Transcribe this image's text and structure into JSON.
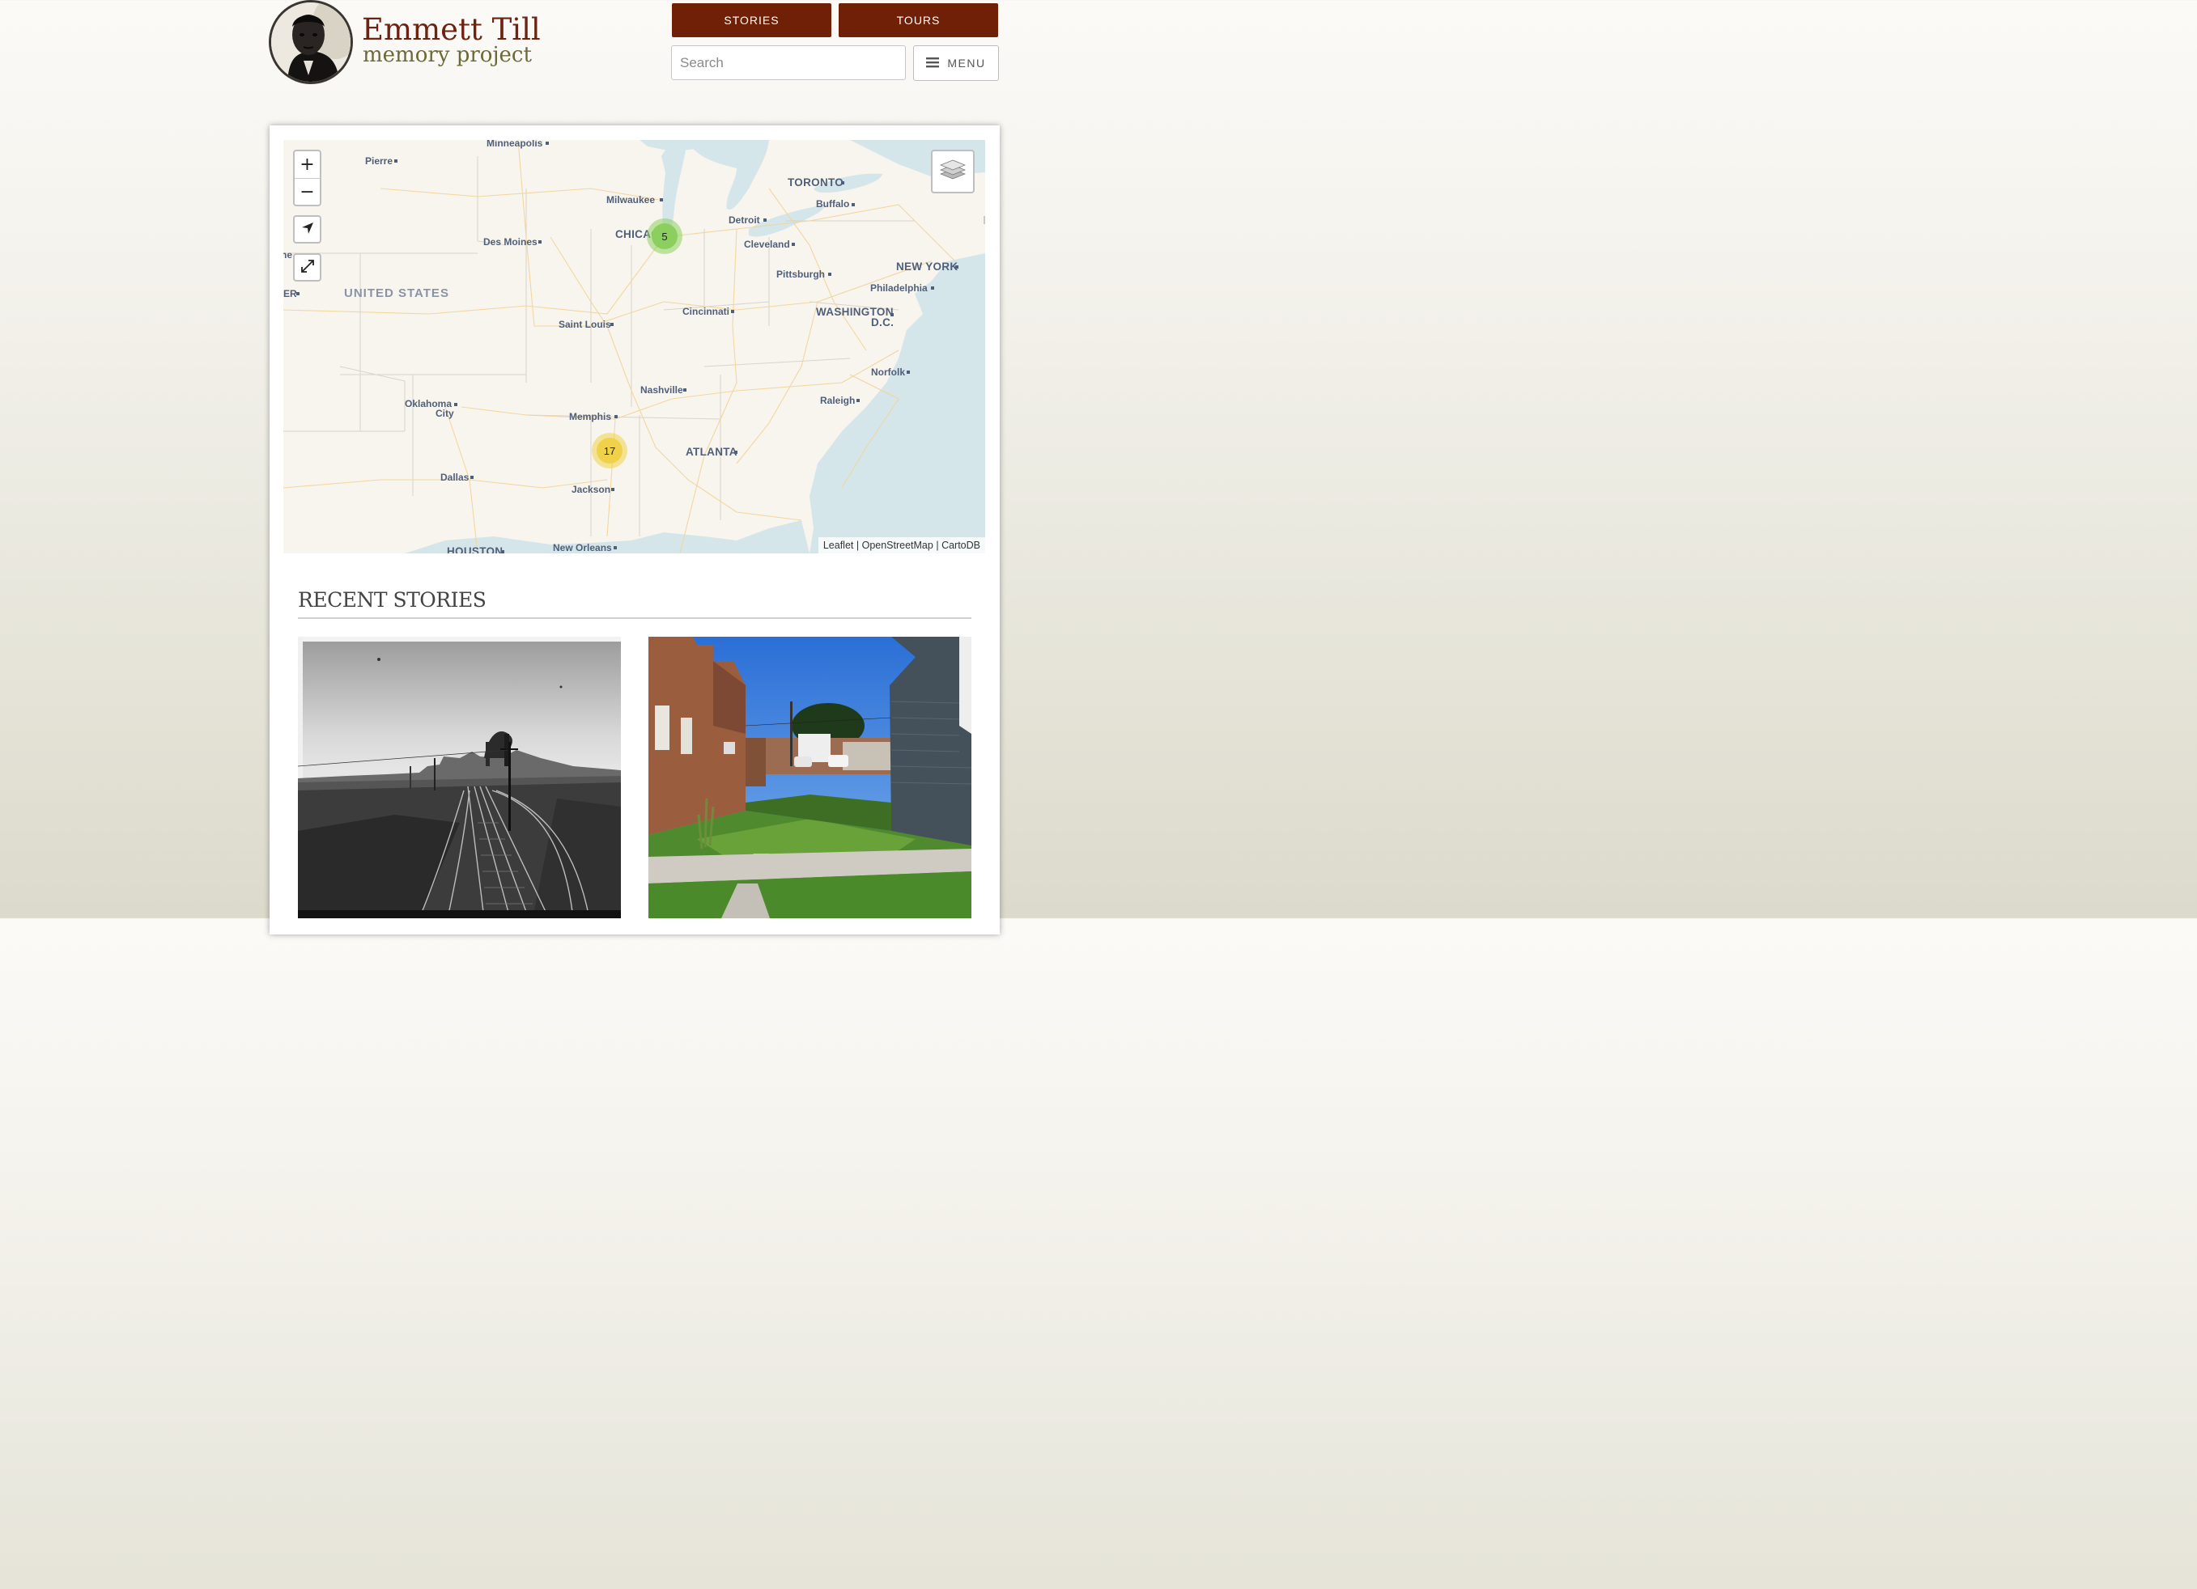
{
  "header": {
    "title": "Emmett Till",
    "subtitle": "memory project",
    "nav": {
      "stories": "STORIES",
      "tours": "TOURS"
    },
    "search_placeholder": "Search",
    "menu_label": "MENU"
  },
  "map": {
    "country_label": "UNITED STATES",
    "cities": {
      "minneapolis": "Minneapolis",
      "pierre": "Pierre",
      "milwaukee": "Milwaukee",
      "toronto": "TORONTO",
      "buffalo": "Buffalo",
      "detroit": "Detroit",
      "chicago": "CHICAGO",
      "cleveland": "Cleveland",
      "des_moines": "Des Moines",
      "pittsburgh": "Pittsburgh",
      "new_york": "NEW YORK",
      "philadelphia": "Philadelphia",
      "washington": "WASHINGTON",
      "dc": "D.C.",
      "cincinnati": "Cincinnati",
      "saint_louis": "Saint Louis",
      "norfolk": "Norfolk",
      "nashville": "Nashville",
      "raleigh": "Raleigh",
      "oklahoma": "Oklahoma",
      "city": "City",
      "memphis": "Memphis",
      "atlanta": "ATLANTA",
      "dallas": "Dallas",
      "jackson": "Jackson",
      "houston": "HOUSTON",
      "new_orleans": "New Orleans",
      "edge_left_top": "ne",
      "edge_left_mid": "ER"
    },
    "clusters": {
      "chicago_count": "5",
      "mississippi_count": "17"
    },
    "zoom_in": "+",
    "zoom_out": "−",
    "attribution": {
      "leaflet": "Leaflet",
      "osm": "OpenStreetMap",
      "carto": "CartoDB",
      "sep": "|"
    },
    "colors": {
      "land": "#f8f5ee",
      "water": "#d4e6ea",
      "roads": "#f6d79b",
      "cluster_green": "#8ccf5f",
      "cluster_yellow": "#f0d24a"
    }
  },
  "recent": {
    "heading": "RECENT STORIES"
  },
  "brand_colors": {
    "maroon": "#6f2007",
    "olive": "#6b6a36"
  }
}
